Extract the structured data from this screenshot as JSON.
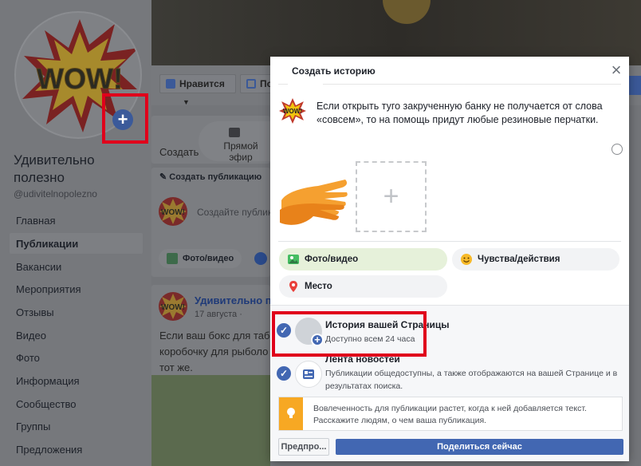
{
  "page": {
    "name": "Удивительно полезно",
    "handle": "@udivitelnopolezno",
    "nav": [
      "Главная",
      "Публикации",
      "Вакансии",
      "Мероприятия",
      "Отзывы",
      "Видео",
      "Фото",
      "Информация",
      "Сообщество",
      "Группы",
      "Предложения"
    ],
    "like_label": "Нравится",
    "share_label_partial": "По",
    "create_label": "Создать",
    "live_label": "Прямой эфир",
    "create_post_label": "Создать публикацию",
    "composer_placeholder": "Создайте публика",
    "photo_video_label": "Фото/видео",
    "post_author": "Удивительно по",
    "post_date": "17 августа · ",
    "post_text": "Если ваш бокс для таб коробочку для рыболо тот же.",
    "logo_text": "WOW!"
  },
  "modal": {
    "title": "Создать историю",
    "text": "Если открыть туго закрученную банку не получается от слова «совсем», то на помощь придут любые резиновые перчатки.",
    "options": {
      "photo_video": "Фото/видео",
      "feelings": "Чувства/действия",
      "place": "Место"
    },
    "destinations": [
      {
        "title": "История вашей Страницы",
        "subtitle": "Доступно всем 24 часа"
      },
      {
        "title": "Лента новостей",
        "subtitle": "Публикации общедоступны, а также отображаются на вашей Странице и в результатах поиска."
      }
    ],
    "info": "Вовлеченность для публикации растет, когда к ней добавляется текст. Расскажите людям, о чем ваша публикация.",
    "preview_button": "Предпро...",
    "share_button": "Поделиться сейчас",
    "close_symbol": "×",
    "plus_symbol": "+"
  },
  "colors": {
    "accent": "#4267b2",
    "highlight_box": "#e0001b",
    "info_stripe": "#f7a823"
  },
  "icons": [
    "plus-icon",
    "close-icon",
    "photo-icon",
    "emoji-icon",
    "location-pin-icon",
    "check-icon",
    "newsfeed-icon",
    "lightbulb-icon",
    "camera-icon",
    "pencil-icon",
    "thumbs-up-icon",
    "messenger-icon"
  ]
}
